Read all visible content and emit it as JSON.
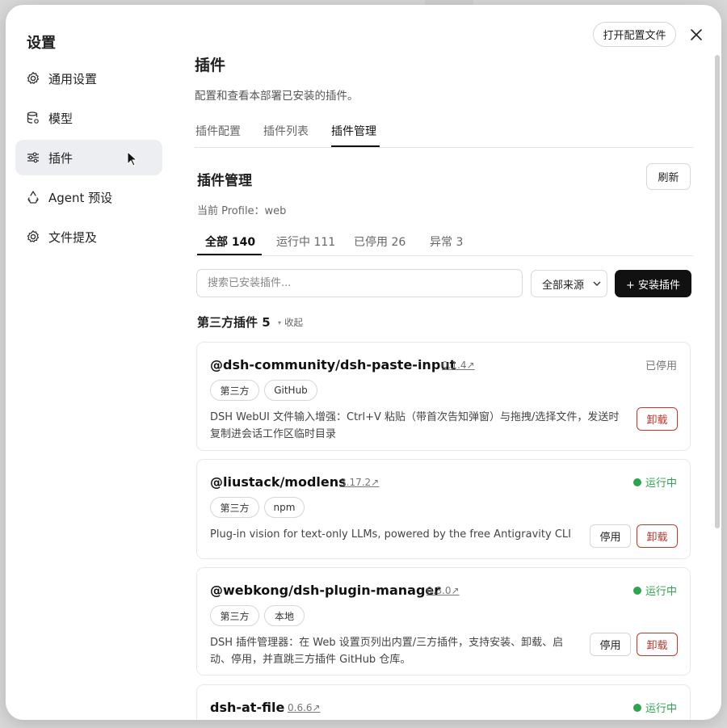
{
  "modal": {
    "title": "设置",
    "open_config_label": "打开配置文件"
  },
  "sidebar": {
    "items": [
      {
        "label": "通用设置",
        "icon": "gear-icon"
      },
      {
        "label": "模型",
        "icon": "database-icon"
      },
      {
        "label": "插件",
        "icon": "sliders-icon",
        "active": true
      },
      {
        "label": "Agent 预设",
        "icon": "recycle-icon"
      },
      {
        "label": "文件提及",
        "icon": "gear-icon"
      }
    ]
  },
  "page": {
    "title": "插件",
    "description": "配置和查看本部署已安装的插件。",
    "tabs": [
      "插件配置",
      "插件列表",
      "插件管理"
    ],
    "active_tab": "插件管理"
  },
  "manager": {
    "title": "插件管理",
    "refresh_label": "刷新",
    "profile_line": "当前 Profile：web",
    "filters": [
      "全部 140",
      "运行中 111",
      "已停用 26",
      "异常 3"
    ],
    "search_placeholder": "搜索已安装插件...",
    "source_select": "全部来源",
    "install_label": "+ 安装插件",
    "group_title": "第三方插件 5",
    "collapse_label": "收起"
  },
  "plugins": [
    {
      "name": "@dsh-community/dsh-paste-input",
      "version": "0.1.4↗",
      "status": "已停用",
      "tags": [
        "第三方",
        "GitHub"
      ],
      "desc_line1": "DSH WebUI 文件输入增强：Ctrl+V 粘贴（带首次告知弹窗）与拖拽/选择文件，发送时",
      "desc_line2": "复制进会话工作区临时目录",
      "uninstall_label": "卸载"
    },
    {
      "name": "@liustack/modlens",
      "version": "3.17.2↗",
      "status": "运行中",
      "tags": [
        "第三方",
        "npm"
      ],
      "desc_line1": "Plug-in vision for text-only LLMs, powered by the free Antigravity CLI",
      "stop_label": "停用",
      "uninstall_label": "卸载"
    },
    {
      "name": "@webkong/dsh-plugin-manager",
      "version": "0.3.0↗",
      "status": "运行中",
      "tags": [
        "第三方",
        "本地"
      ],
      "desc_line1": "DSH 插件管理器：在 Web 设置页列出内置/三方插件，支持安装、卸载、启",
      "desc_line2": "动、停用，并直跳三方插件 GitHub 仓库。",
      "stop_label": "停用",
      "uninstall_label": "卸载"
    },
    {
      "name": "dsh-at-file",
      "version": "0.6.6↗",
      "status": "运行中"
    }
  ],
  "colors": {
    "running": "#2ea44f",
    "danger": "#c0392b",
    "primary_button": "#111111"
  }
}
